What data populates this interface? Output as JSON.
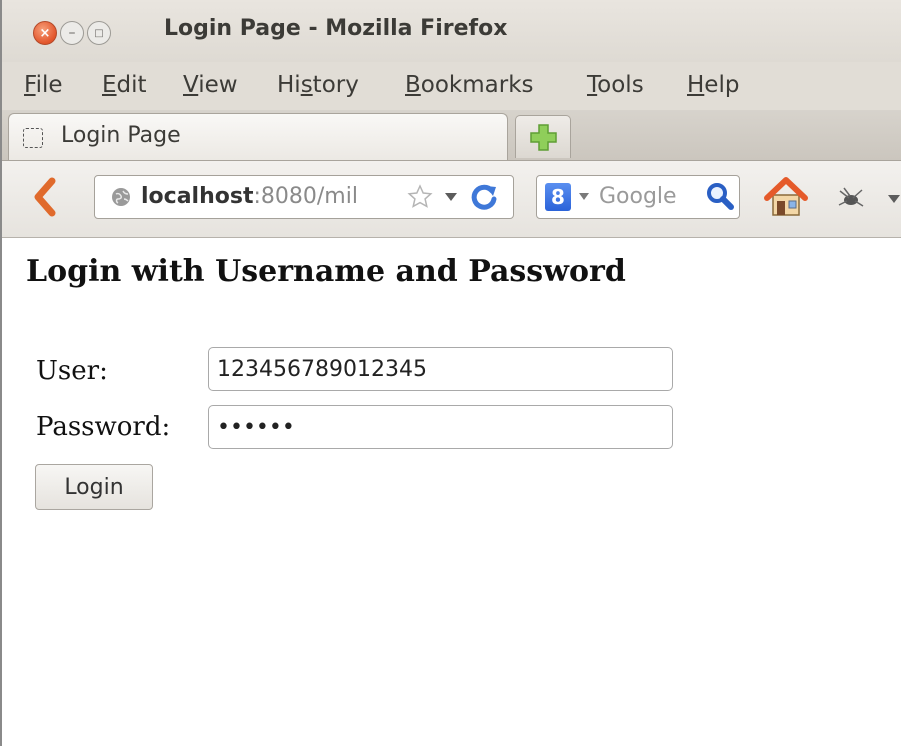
{
  "window": {
    "title": "Login Page - Mozilla Firefox"
  },
  "menu": [
    {
      "pre": "",
      "u": "F",
      "post": "ile"
    },
    {
      "pre": "",
      "u": "E",
      "post": "dit"
    },
    {
      "pre": "",
      "u": "V",
      "post": "iew"
    },
    {
      "pre": "Hi",
      "u": "s",
      "post": "tory"
    },
    {
      "pre": "",
      "u": "B",
      "post": "ookmarks"
    },
    {
      "pre": "",
      "u": "T",
      "post": "ools"
    },
    {
      "pre": "",
      "u": "H",
      "post": "elp"
    }
  ],
  "tab": {
    "label": "Login Page"
  },
  "nav": {
    "url_host": "localhost",
    "url_rest": ":8080/mil",
    "search_engine_letter": "8",
    "search_placeholder": "Google"
  },
  "page": {
    "heading": "Login with Username and Password",
    "user_label": "User:",
    "user_value": "123456789012345",
    "password_label": "Password:",
    "password_value": "••••••",
    "login_button": "Login"
  },
  "colors": {
    "close_button": "#e2552b",
    "back_arrow": "#e06a2c",
    "reload": "#3f78d8",
    "home_roof": "#e55a2a"
  },
  "icons": [
    "close-icon",
    "minimize-icon",
    "maximize-icon",
    "page-icon",
    "new-tab-plus-icon",
    "back-arrow-icon",
    "globe-icon",
    "star-icon",
    "reload-icon",
    "google-icon",
    "magnifier-icon",
    "home-icon",
    "addon-icon",
    "chevron-down-icon"
  ]
}
